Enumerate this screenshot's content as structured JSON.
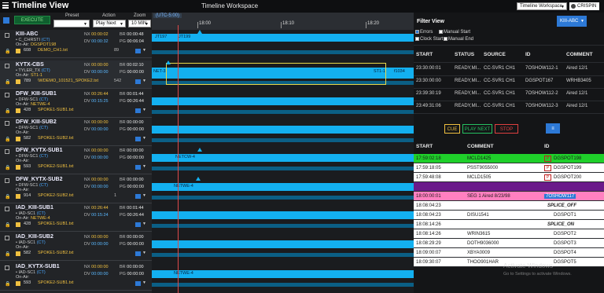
{
  "app": {
    "title": "Timeline View",
    "workspace_title": "Timeline Workspace",
    "workspace_select": "Timeline Workspace",
    "user": "CRISPIN"
  },
  "controls": {
    "execute_label": "EXECUTE",
    "preset_label": "Preset",
    "preset_value": "",
    "action_label": "Action",
    "action_value": "Play Next",
    "zoom_label": "Zoom",
    "zoom_value": "10 MIN"
  },
  "channels": [
    {
      "name": "KIII-ABC",
      "chan": "C_CHRSTI",
      "ct": "(CT)",
      "onair_label": "On-Air:",
      "onair": "DGSPOT198",
      "num": "608",
      "file": "DEMO_CH1.txt",
      "nx": "00:00:02",
      "dv": "00:00:32",
      "br": "00:00:48",
      "pg": "00:06:04",
      "extra": "89"
    },
    {
      "name": "KYTX-CBS",
      "chan": "TYLER_TX",
      "ct": "(CT)",
      "onair_label": "On-Air:",
      "onair": "ST1-1",
      "num": "789",
      "file": "\\WDEMO_101521_SPOKE2.txt",
      "nx": "00:00:00",
      "dv": "00:00:00",
      "br": "00:02:10",
      "pg": "00:00:00",
      "extra": "542"
    },
    {
      "name": "DFW_KIII-SUB1",
      "chan": "DFW-SC1",
      "ct": "(CT)",
      "onair_label": "On-Air:",
      "onair": "NETWE-4",
      "num": "428",
      "file": "SPOKE1-SUB1.txt",
      "nx": "00:26:44",
      "dv": "00:15:25",
      "br": "00:01:44",
      "pg": "00:26:44",
      "extra": ""
    },
    {
      "name": "DFW_KIII-SUB2",
      "chan": "DFW-SC1",
      "ct": "(CT)",
      "onair_label": "On-Air:",
      "onair": "",
      "num": "582",
      "file": "SPOKE1-SUB2.txt",
      "nx": "00:00:00",
      "dv": "00:00:00",
      "br": "00:00:00",
      "pg": "00:00:00",
      "extra": ""
    },
    {
      "name": "DFW_KYTX-SUB1",
      "chan": "DFW-SC1",
      "ct": "(CT)",
      "onair_label": "On-Air:",
      "onair": "",
      "num": "593",
      "file": "SPOKE2-SUB1.txt",
      "nx": "00:00:00",
      "dv": "00:00:00",
      "br": "00:00:00",
      "pg": "00:00:00",
      "extra": ""
    },
    {
      "name": "DFW_KYTX-SUB2",
      "chan": "DFW-SC1",
      "ct": "(CT)",
      "onair_label": "On-Air:",
      "onair": "",
      "num": "914",
      "file": "SPOKE2-SUB2.txt",
      "nx": "00:00:00",
      "dv": "00:00:00",
      "br": "00:00:00",
      "pg": "00:00:00",
      "extra": "1"
    },
    {
      "name": "IAD_KIII-SUB1",
      "chan": "IAD-SC1",
      "ct": "(CT)",
      "onair_label": "On-Air:",
      "onair": "NETWE-4",
      "num": "428",
      "file": "SPOKE1-SUB1.txt",
      "nx": "00:26:44",
      "dv": "00:15:24",
      "br": "00:01:44",
      "pg": "00:26:44",
      "extra": ""
    },
    {
      "name": "IAD_KIII-SUB2",
      "chan": "IAD-SC1",
      "ct": "(CT)",
      "onair_label": "On-Air:",
      "onair": "",
      "num": "582",
      "file": "SPOKE1-SUB2.txt",
      "nx": "00:00:00",
      "dv": "00:00:00",
      "br": "00:00:00",
      "pg": "00:00:00",
      "extra": ""
    },
    {
      "name": "IAD_KYTX-SUB1",
      "chan": "IAD-SC1",
      "ct": "(CT)",
      "onair_label": "On-Air:",
      "onair": "",
      "num": "593",
      "file": "SPOKE2-SUB1.txt",
      "nx": "00:00:00",
      "dv": "00:00:00",
      "br": "00:00:00",
      "pg": "00:00:00",
      "extra": ""
    }
  ],
  "stat_labels": {
    "nx": "NX",
    "dv": "DV",
    "br": "BR",
    "pg": "PG"
  },
  "timeline": {
    "utc_label": "(UTC-5:00)",
    "ticks": [
      "18:00",
      "18:10",
      "18:20"
    ],
    "bar_labels": [
      "JT197",
      "JT199",
      "NET-3",
      "ST1-1",
      "f1034",
      "NETCW-4",
      "NETWE-4",
      "NETWE-4"
    ]
  },
  "panel": {
    "title": "Filter View",
    "filter_value": "KIII-ABC",
    "checks": [
      {
        "label": "Errors",
        "checked": true
      },
      {
        "label": "Manual Start",
        "checked": false
      },
      {
        "label": "Clock Start",
        "checked": false
      },
      {
        "label": "Manual End",
        "checked": false
      }
    ],
    "log_headers": [
      "START",
      "STATUS",
      "SOURCE",
      "ID",
      "COMMENT"
    ],
    "log_rows": [
      [
        "23:30:00:01",
        "READY,MI...",
        "CC-SVR1 CH1",
        "7OSHOW112-1",
        "Aired 12/1"
      ],
      [
        "23:30:00:00",
        "READY,MI...",
        "CC-SVR1 CH1",
        "DGSPOT167",
        "WRHB3405"
      ],
      [
        "23:39:30:19",
        "READY,MI...",
        "CC-SVR1 CH1",
        "7OSHOW112-2",
        "Aired 12/1"
      ],
      [
        "23:49:31:06",
        "READY,MI...",
        "CC-SVR1 CH1",
        "7OSHOW112-3",
        "Aired 12/1"
      ]
    ],
    "btn_cue": "CUE",
    "btn_play_next": "PLAY NEXT",
    "btn_stop": "STOP",
    "sched_headers": [
      "START",
      "COMMENT",
      "ID"
    ],
    "sched_rows": [
      {
        "start": "17:59:02:18",
        "comment": "MCLD1425",
        "id": "DGSPOT198",
        "badge": "P",
        "color": "#1fd02a"
      },
      {
        "start": "17:59:18:05",
        "comment": "PSST9055000",
        "id": "DGSPOT199",
        "badge": "P",
        "color": "#ffffff"
      },
      {
        "start": "17:59:48:08",
        "comment": "MCLD1505",
        "id": "DGSPOT200",
        "badge": "P",
        "color": "#ffffff"
      },
      {
        "start": "",
        "comment": "",
        "id": "",
        "badge": "",
        "color": "#6a1a8a"
      },
      {
        "start": "18:00:00:01",
        "comment": "SEG 1 Aired 8/23/98",
        "id": "7OSHOW117",
        "badge": "",
        "color": "#ff80c0"
      },
      {
        "start": "18:08:04:23",
        "comment": "",
        "id": "SPLICE_OFF",
        "badge": "",
        "color": "#ffffff"
      },
      {
        "start": "18:08:04:23",
        "comment": "DISU1541",
        "id": "DGSPOT1",
        "badge": "",
        "color": "#ffffff"
      },
      {
        "start": "18:08:14:26",
        "comment": "",
        "id": "SPLICE_ON",
        "badge": "",
        "color": "#ffffff"
      },
      {
        "start": "18:08:14:26",
        "comment": "WRIN3615",
        "id": "DGSPOT2",
        "badge": "",
        "color": "#ffffff"
      },
      {
        "start": "18:08:29:29",
        "comment": "DOTH9036000",
        "id": "DGSPOT3",
        "badge": "",
        "color": "#ffffff"
      },
      {
        "start": "18:09:00:07",
        "comment": "XBYA0009",
        "id": "DGSPOT4",
        "badge": "",
        "color": "#ffffff"
      },
      {
        "start": "18:09:30:07",
        "comment": "THOO901HAR",
        "id": "DGSPOT5",
        "badge": "",
        "color": "#ffffff"
      }
    ],
    "watermark": "Activate Windows",
    "watermark_sub": "Go to Settings to activate Windows."
  }
}
